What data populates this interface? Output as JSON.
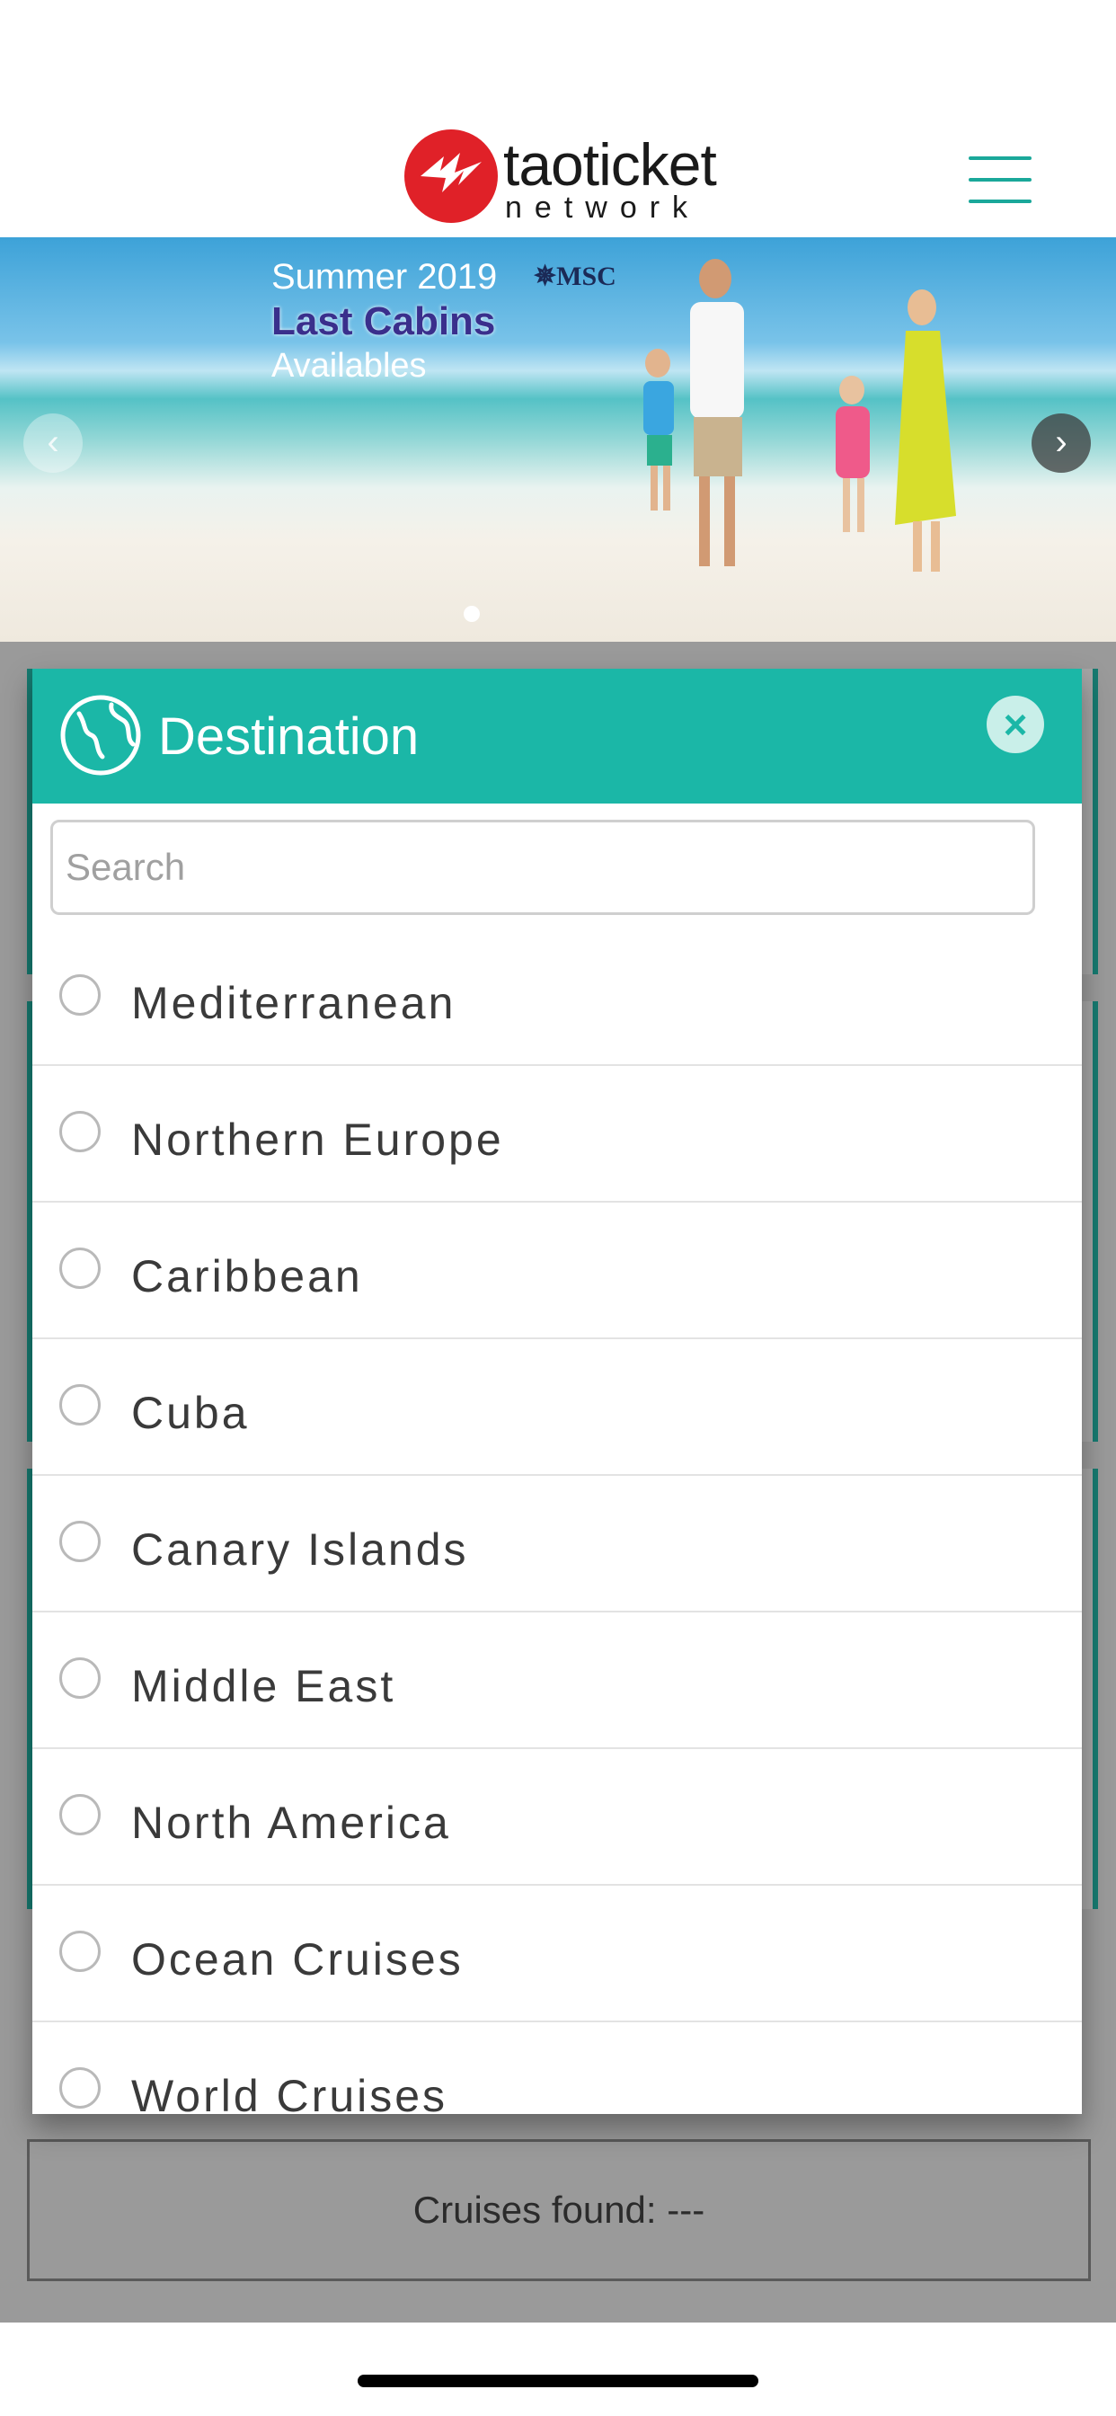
{
  "header": {
    "logo_word": "taoticket",
    "logo_sub": "network",
    "menu_icon": "hamburger-icon",
    "accent": "#1aa89a",
    "logo_color": "#e02128"
  },
  "banner": {
    "line1": "Summer 2019",
    "line2": "Last Cabins",
    "line3": "Availables",
    "brand": "MSC",
    "prev_icon": "chevron-left-icon",
    "next_icon": "chevron-right-icon"
  },
  "modal": {
    "title": "Destination",
    "title_icon": "globe-icon",
    "close_icon": "close-icon",
    "search_placeholder": "Search",
    "header_color": "#1bb7a7",
    "items": [
      {
        "label": "Mediterranean"
      },
      {
        "label": "Northern Europe"
      },
      {
        "label": "Caribbean"
      },
      {
        "label": "Cuba"
      },
      {
        "label": "Canary Islands"
      },
      {
        "label": "Middle East"
      },
      {
        "label": "North America"
      },
      {
        "label": "Ocean Cruises"
      },
      {
        "label": "World Cruises"
      }
    ]
  },
  "footer": {
    "cruises_found": "Cruises found: ---"
  }
}
